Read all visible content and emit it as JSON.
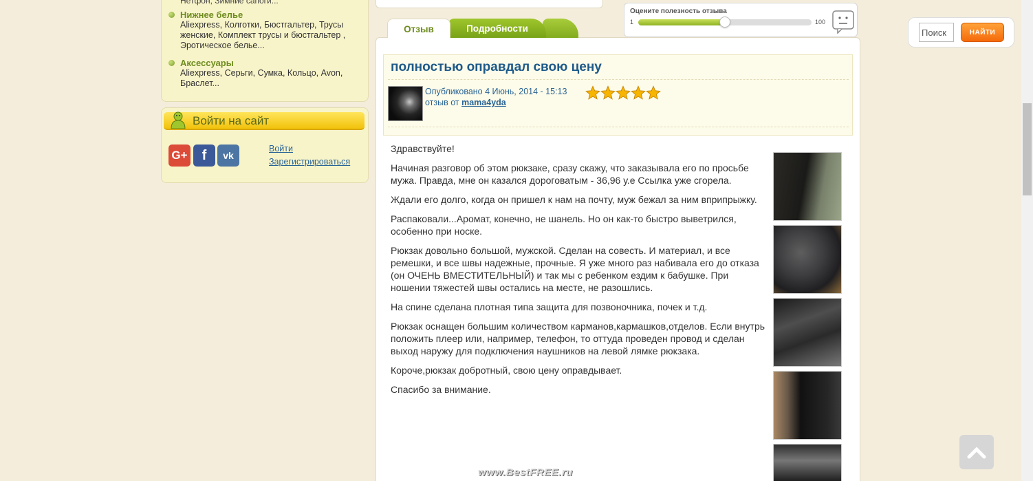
{
  "sidebar": {
    "cut_text": "Нетфон, Зимние сапоги...",
    "categories": [
      {
        "title": "Нижнее белье",
        "desc": "Aliexpress, Колготки, Бюстгальтер, Трусы женские, Комплект трусы и бюстгальтер , Эротическое белье..."
      },
      {
        "title": "Аксессуары",
        "desc": "Aliexpress, Серьги, Сумка, Кольцо, Avon, Браслет..."
      }
    ],
    "login": {
      "title": "Войти на сайт",
      "login_link": "Войти",
      "register_link": "Зарегистрироваться",
      "social": [
        "G+",
        "f",
        "vk"
      ]
    }
  },
  "rating_widget": {
    "title": "Оцените полезность отзыва",
    "min": "1",
    "max": "100",
    "value": 50
  },
  "search": {
    "placeholder": "Поиск",
    "button": "НАЙТИ"
  },
  "tabs": [
    {
      "label": "Отзыв",
      "active": true
    },
    {
      "label": "Подробности",
      "active": false
    }
  ],
  "review": {
    "title": "полностью оправдал свою цену",
    "published": "Опубликовано 4 Июнь, 2014 - 15:13",
    "author_prefix": "отзыв от ",
    "author": "mama4yda",
    "stars": 5,
    "paragraphs": [
      "Здравствуйте!",
      "Начиная разговор об этом рюкзаке, сразу скажу, что заказывала его по просьбе мужа. Правда, мне он казался дороговатым - 36,96 у.е Ссылка уже сгорела.",
      "Ждали его долго, когда он пришел к нам на почту, муж бежал за ним вприпрыжку.",
      "Распаковали...Аромат, конечно, не шанель. Но он как-то быстро выветрился, особенно при носке.",
      "Рюкзак довольно большой, мужской. Сделан на совесть. И материал, и все ремешки, и все швы надежные, прочные. Я уже много раз набивала его до отказа (он ОЧЕНЬ ВМЕСТИТЕЛЬНЫЙ) и так мы с ребенком ездим к бабушке. При ношении тяжестей швы остались на месте, не разошлись.",
      "На спине сделана плотная типа защита для позвоночника, почек и т.д.",
      "Рюкзак оснащен большим количеством карманов,кармашков,отделов. Если внутрь положить плеер или, например, телефон, то оттуда проведен провод и сделан выход наружу для подключения наушников на левой лямке рюкзака.",
      "Короче,рюкзак добротный, свою цену оправдывает.",
      "Спасибо за внимание."
    ]
  },
  "watermark": "www.BestFREE.ru",
  "colors": {
    "page_bg": "#f4eddc",
    "sidebar_bg": "#f8f4c9",
    "accent_green": "#8fb224",
    "link_blue": "#2a6496",
    "search_orange": "#f56a0a"
  }
}
